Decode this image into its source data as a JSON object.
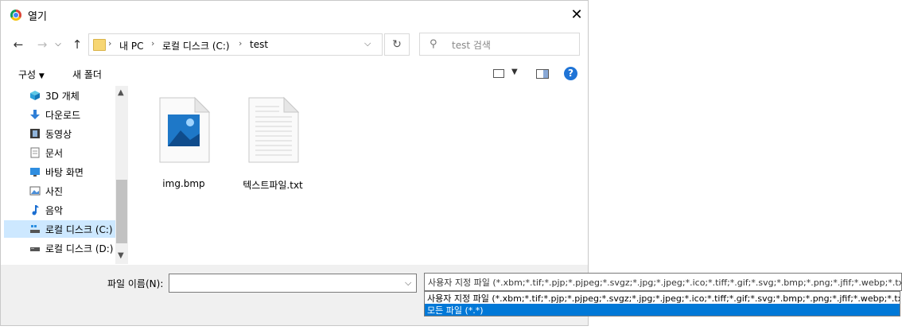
{
  "window": {
    "title": "열기",
    "close_symbol": "✕"
  },
  "nav": {
    "back": "←",
    "forward": "→",
    "up": "↑",
    "refresh": "↻",
    "dropdown": "⌵",
    "breadcrumb_sep": "›",
    "breadcrumb": [
      "내 PC",
      "로컬 디스크 (C:)",
      "test"
    ]
  },
  "search": {
    "placeholder": "test 검색",
    "icon": "search-icon"
  },
  "toolbar": {
    "organize_label": "구성",
    "new_folder_label": "새 폴더",
    "help": "?"
  },
  "nav_pane": {
    "items": [
      {
        "label": "3D 개체",
        "icon": "cube-icon"
      },
      {
        "label": "다운로드",
        "icon": "download-arrow-icon"
      },
      {
        "label": "동영상",
        "icon": "film-icon"
      },
      {
        "label": "문서",
        "icon": "document-icon"
      },
      {
        "label": "바탕 화면",
        "icon": "desktop-icon"
      },
      {
        "label": "사진",
        "icon": "picture-icon"
      },
      {
        "label": "음악",
        "icon": "music-note-icon"
      },
      {
        "label": "로컬 디스크 (C:)",
        "icon": "drive-icon",
        "selected": true
      },
      {
        "label": "로컬 디스크 (D:)",
        "icon": "drive-icon"
      }
    ]
  },
  "files": [
    {
      "name": "img.bmp",
      "icon": "image-file-icon"
    },
    {
      "name": "텍스트파일.txt",
      "icon": "text-file-icon"
    }
  ],
  "filename": {
    "label": "파일 이름(N):",
    "value": ""
  },
  "filetype": {
    "selected": "사용자 지정 파일 (*.xbm;*.tif;*.pjp;*.pjpeg;*.svgz;*.jpg;*.jpeg;*.ico;*.tiff;*.gif;*.svg;*.bmp;*.png;*.jfif;*.webp;*.txt)",
    "options": [
      "사용자 지정 파일 (*.xbm;*.tif;*.pjp;*.pjpeg;*.svgz;*.jpg;*.jpeg;*.ico;*.tiff;*.gif;*.svg;*.bmp;*.png;*.jfif;*.webp;*.txt)",
      "모든 파일 (*.*)"
    ],
    "highlighted_index": 1
  },
  "colors": {
    "selection": "#cde8ff",
    "highlight": "#0078d7",
    "help": "#1f74d6"
  }
}
